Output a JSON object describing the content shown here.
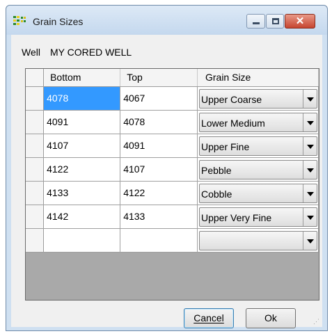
{
  "window": {
    "title": "Grain Sizes",
    "icon": "grain-sizes-app-icon"
  },
  "caption_buttons": {
    "close_glyph": "✕"
  },
  "well": {
    "label": "Well",
    "name": "MY CORED WELL"
  },
  "grid": {
    "columns": [
      "Bottom",
      "Top",
      "Grain Size"
    ],
    "rows": [
      {
        "bottom": "4078",
        "top": "4067",
        "grain_size": "Upper Coarse"
      },
      {
        "bottom": "4091",
        "top": "4078",
        "grain_size": "Lower Medium"
      },
      {
        "bottom": "4107",
        "top": "4091",
        "grain_size": "Upper Fine"
      },
      {
        "bottom": "4122",
        "top": "4107",
        "grain_size": "Pebble"
      },
      {
        "bottom": "4133",
        "top": "4122",
        "grain_size": "Cobble"
      },
      {
        "bottom": "4142",
        "top": "4133",
        "grain_size": "Upper Very Fine"
      },
      {
        "bottom": "",
        "top": "",
        "grain_size": ""
      }
    ]
  },
  "buttons": {
    "cancel": "Cancel",
    "ok": "Ok"
  },
  "colors": {
    "selection": "#3399ff",
    "grid_background": "#a9a9a9",
    "close_button": "#c64530"
  }
}
